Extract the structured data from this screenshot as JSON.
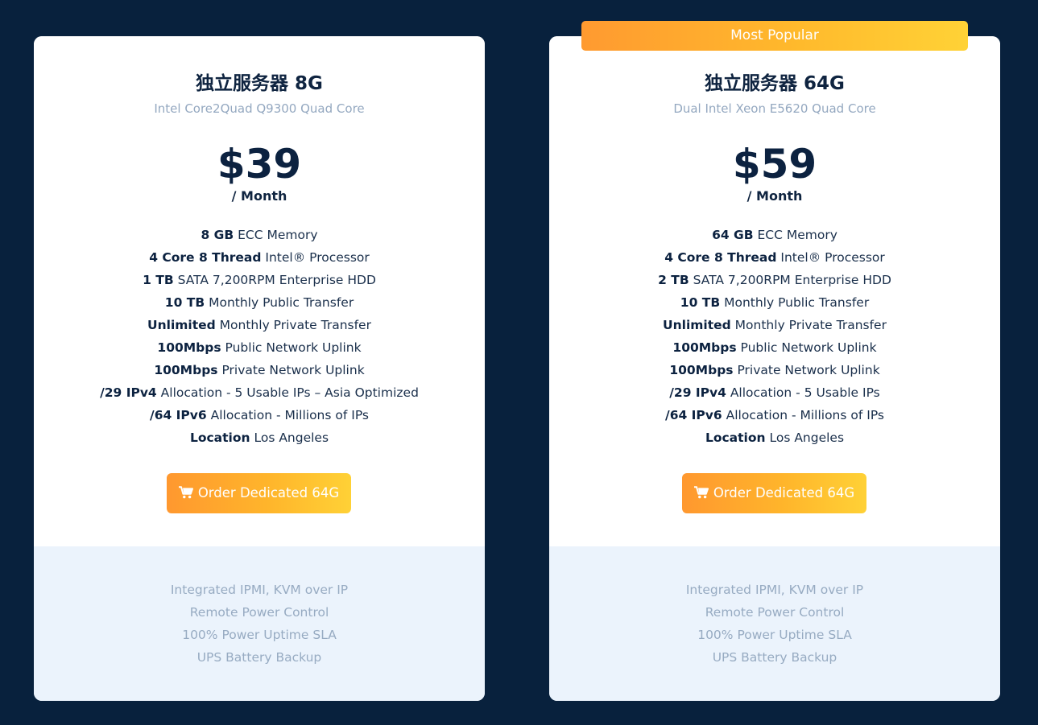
{
  "badge": {
    "label": "Most Popular"
  },
  "plans": [
    {
      "title": "独立服务器 8G",
      "cpu": "Intel Core2Quad Q9300 Quad Core",
      "price": "$39",
      "period": "/ Month",
      "features": [
        {
          "bold": "8 GB",
          "text": " ECC Memory"
        },
        {
          "bold": "4 Core 8 Thread",
          "text": " Intel® Processor"
        },
        {
          "bold": "1 TB",
          "text": " SATA 7,200RPM Enterprise HDD"
        },
        {
          "bold": "10 TB",
          "text": " Monthly Public Transfer"
        },
        {
          "bold": "Unlimited",
          "text": " Monthly Private Transfer"
        },
        {
          "bold": "100Mbps",
          "text": " Public Network Uplink"
        },
        {
          "bold": "100Mbps",
          "text": " Private Network Uplink"
        },
        {
          "bold": "/29 IPv4",
          "text": " Allocation - 5 Usable IPs – Asia Optimized"
        },
        {
          "bold": "/64 IPv6",
          "text": " Allocation - Millions of IPs"
        },
        {
          "bold": "Location",
          "text": " Los Angeles"
        }
      ],
      "order_label": "Order Dedicated 64G",
      "extras": [
        "Integrated IPMI, KVM over IP",
        "Remote Power Control",
        "100% Power Uptime SLA",
        "UPS Battery Backup"
      ]
    },
    {
      "title": "独立服务器 64G",
      "cpu": "Dual Intel Xeon E5620 Quad Core",
      "price": "$59",
      "period": "/ Month",
      "features": [
        {
          "bold": "64 GB",
          "text": " ECC Memory"
        },
        {
          "bold": "4 Core 8 Thread",
          "text": " Intel® Processor"
        },
        {
          "bold": "2 TB",
          "text": " SATA 7,200RPM Enterprise HDD"
        },
        {
          "bold": "10 TB",
          "text": " Monthly Public Transfer"
        },
        {
          "bold": "Unlimited",
          "text": " Monthly Private Transfer"
        },
        {
          "bold": "100Mbps",
          "text": " Public Network Uplink"
        },
        {
          "bold": "100Mbps",
          "text": " Private Network Uplink"
        },
        {
          "bold": "/29 IPv4",
          "text": " Allocation - 5 Usable IPs"
        },
        {
          "bold": "/64 IPv6",
          "text": " Allocation - Millions of IPs"
        },
        {
          "bold": "Location",
          "text": " Los Angeles"
        }
      ],
      "order_label": "Order Dedicated 64G",
      "extras": [
        "Integrated IPMI, KVM over IP",
        "Remote Power Control",
        "100% Power Uptime SLA",
        "UPS Battery Backup"
      ]
    }
  ],
  "colors": {
    "page_background": "#08213d",
    "card_background": "#ffffff",
    "card_footer_background": "#ebf3fc",
    "accent_start": "#ff982f",
    "accent_end": "#ffd136",
    "heading_text": "#0c2240",
    "muted_text": "#94a8c0"
  },
  "icons": {
    "order_button_icon": "shopping-cart-icon"
  }
}
